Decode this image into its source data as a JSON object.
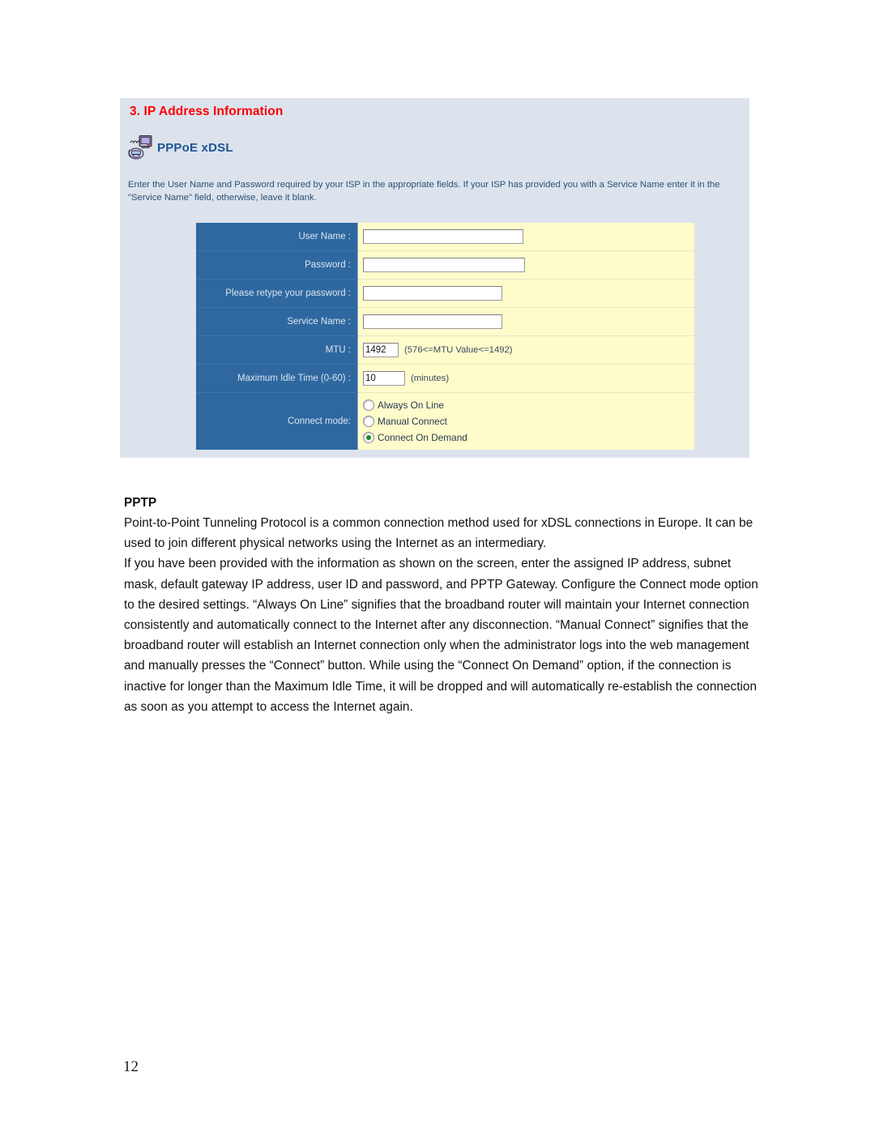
{
  "page": {
    "number": "12"
  },
  "ui_panel": {
    "section_title": "3. IP Address Information",
    "protocol_icon": "modem-phone-icon",
    "protocol_label": "PPPoE xDSL",
    "intro_text": "Enter the User Name and Password required by your ISP in the appropriate fields. If your ISP has provided you with a Service Name enter it in the \"Service Name\" field, otherwise, leave it blank.",
    "form": {
      "rows": [
        {
          "label": "User Name :",
          "value": ""
        },
        {
          "label": "Password :",
          "value": ""
        },
        {
          "label": "Please retype your password :",
          "value": ""
        },
        {
          "label": "Service Name :",
          "value": ""
        },
        {
          "label": "MTU :",
          "value": "1492",
          "hint": "(576<=MTU Value<=1492)"
        },
        {
          "label": "Maximum Idle Time (0-60) :",
          "value": "10",
          "hint": "(minutes)"
        }
      ],
      "connect_mode": {
        "label": "Connect mode:",
        "options": [
          {
            "text": "Always On Line",
            "selected": false
          },
          {
            "text": "Manual Connect",
            "selected": false
          },
          {
            "text": "Connect On Demand",
            "selected": true
          }
        ]
      }
    },
    "colors": {
      "panel_bg": "#dce3ed",
      "title_red": "#fc0000",
      "label_blue": "#2f68a0",
      "field_yellow": "#fffccc",
      "protocol_blue": "#1b5494",
      "radio_selected_green": "#1f8a1f"
    }
  },
  "document": {
    "heading": "PPTP",
    "paragraph_1": "Point-to-Point Tunneling Protocol is a common connection method used for xDSL connections in Europe. It can be used to join different physical networks using the Internet as an intermediary.",
    "paragraph_2": "If you have been provided with the information as shown on the screen, enter the assigned IP address, subnet mask, default gateway IP address, user ID and password, and PPTP Gateway. Configure the Connect mode option to the desired settings. “Always On Line” signifies that the broadband router will maintain your Internet connection consistently and automatically connect to the Internet after any disconnection. “Manual Connect” signifies that the broadband router will establish an Internet connection only when the administrator logs into the web management and manually presses the “Connect” button. While using the “Connect On Demand” option, if the connection is inactive for longer than the Maximum Idle Time, it will be dropped and will automatically re-establish the connection as soon as you attempt to access the Internet again."
  }
}
